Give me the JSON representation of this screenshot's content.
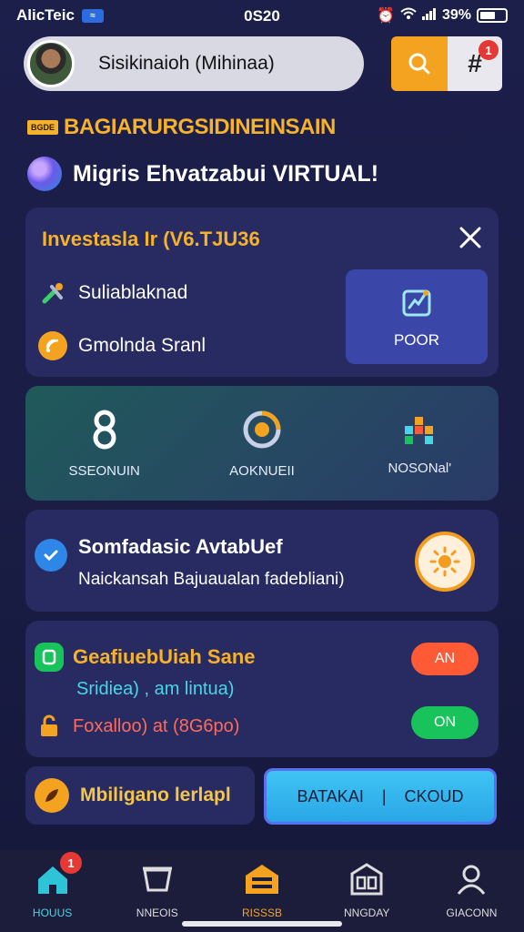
{
  "status_bar": {
    "carrier": "AlicTeic",
    "time": "0S20",
    "battery": "39%"
  },
  "header": {
    "search_text": "Sisikinaioh (Mihinaa)",
    "notification_count": "1"
  },
  "promo": {
    "tag": "BGDE",
    "title": "BAGIARURGSIDINEINSAIN"
  },
  "welcome": {
    "text": "Migris Ehvatzabui VIRTUAL!"
  },
  "invest_card": {
    "title": "Investasla Ir (V6.TJU36",
    "row1_label": "Suliablaknad",
    "row2_label": "Gmolnda Sranl",
    "tile_label": "POOR"
  },
  "features": [
    {
      "label": "SSEONUIN"
    },
    {
      "label": "AOKNUEII"
    },
    {
      "label": "NOSONal'"
    }
  ],
  "account_card": {
    "title": "Somfadasic AvtabUef",
    "subtitle": "Naickansah Bajuaualan fadebliani)"
  },
  "settings_card": {
    "row1_label": "GeafiuebUiah Sane",
    "row2_label": "Sridiea) , am lintua)",
    "row3_label": "Foxalloo) at (8G6po)",
    "toggle1_label": "AN",
    "toggle2_label": "ON"
  },
  "bottom": {
    "action_label": "Mbiligano lerlapl",
    "cta_left": "BATAKAI",
    "cta_right": "CKOUD"
  },
  "tab_bar": {
    "tabs": [
      {
        "label": "HOUUS"
      },
      {
        "label": "NNEOIS"
      },
      {
        "label": "RISSSB"
      },
      {
        "label": "NNGDAY"
      },
      {
        "label": "GIACONN"
      }
    ],
    "home_badge": "1"
  },
  "colors": {
    "background": "#1c1f4a",
    "card": "#272b62",
    "accent_orange": "#f4a321",
    "accent_cyan": "#48d6e6",
    "toggle_red": "#ff5a36",
    "toggle_green": "#19c35b"
  }
}
